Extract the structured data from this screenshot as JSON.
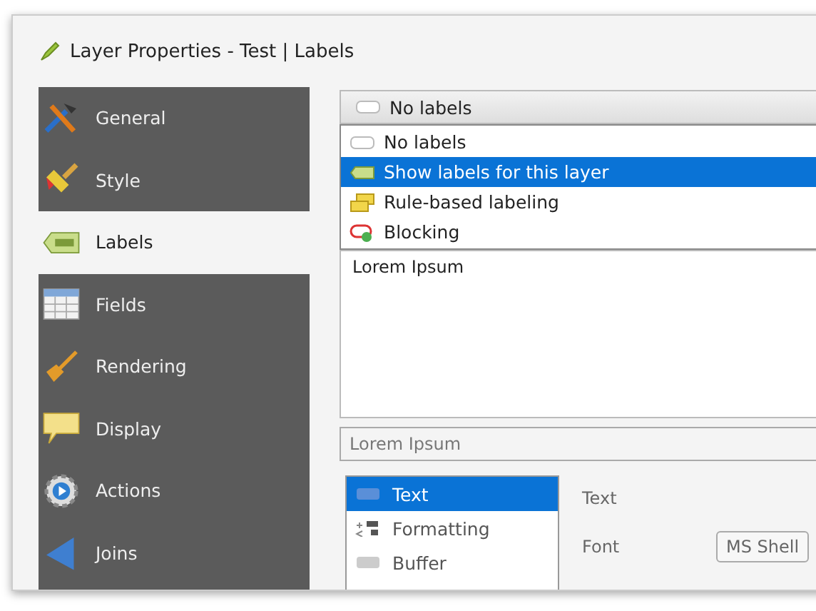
{
  "window": {
    "title": "Layer Properties - Test | Labels"
  },
  "sidebar": {
    "items": [
      {
        "label": "General",
        "kind": "tools",
        "selected": false
      },
      {
        "label": "Style",
        "kind": "brush",
        "selected": false
      },
      {
        "label": "Labels",
        "kind": "abc",
        "selected": true
      },
      {
        "label": "Fields",
        "kind": "table",
        "selected": false
      },
      {
        "label": "Rendering",
        "kind": "paintbrush",
        "selected": false
      },
      {
        "label": "Display",
        "kind": "speech",
        "selected": false
      },
      {
        "label": "Actions",
        "kind": "gear",
        "selected": false
      },
      {
        "label": "Joins",
        "kind": "join",
        "selected": false
      }
    ]
  },
  "mode_combo": {
    "value": "No labels",
    "options": [
      {
        "label": "No labels",
        "kind": "none",
        "highlighted": false
      },
      {
        "label": "Show labels for this layer",
        "kind": "abc",
        "highlighted": true
      },
      {
        "label": "Rule-based labeling",
        "kind": "rules",
        "highlighted": false
      },
      {
        "label": "Blocking",
        "kind": "block",
        "highlighted": false
      }
    ]
  },
  "preview": {
    "text": "Lorem Ipsum"
  },
  "sample_field": {
    "value": "Lorem Ipsum"
  },
  "sections": [
    {
      "label": "Text",
      "kind": "abc",
      "selected": true
    },
    {
      "label": "Formatting",
      "kind": "format",
      "selected": false
    },
    {
      "label": "Buffer",
      "kind": "abc",
      "selected": false
    }
  ],
  "text_settings": {
    "heading": "Text",
    "font_label": "Font",
    "font_value": "MS Shell"
  }
}
